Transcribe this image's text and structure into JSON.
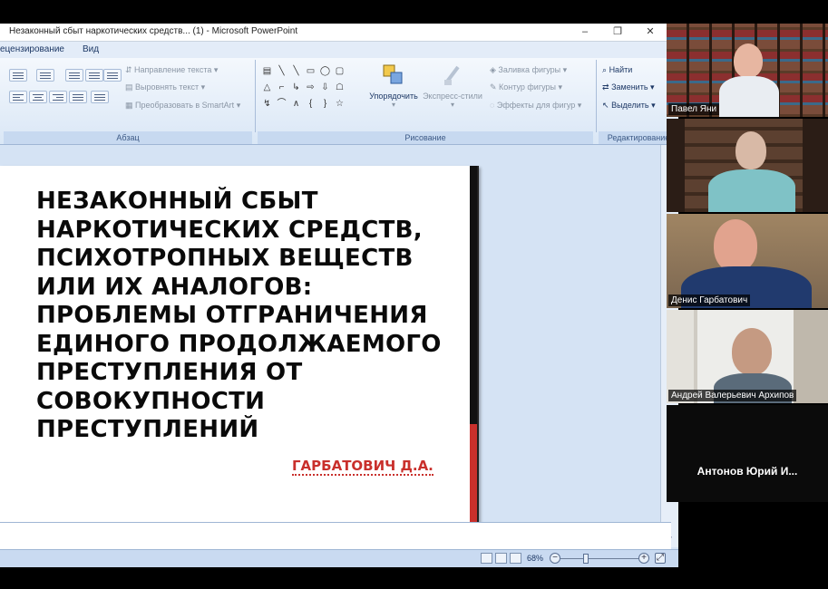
{
  "window": {
    "title": "Незаконный сбыт наркотических средств... (1)  -  Microsoft PowerPoint",
    "minimize": "‒",
    "restore": "❐",
    "close": "✕"
  },
  "tabs": [
    {
      "label": "ецензирование"
    },
    {
      "label": "Вид"
    }
  ],
  "ribbon": {
    "paragraph": {
      "group_label": "Абзац",
      "text_direction": "Направление текста",
      "align_text": "Выровнять текст",
      "smartart": "Преобразовать в SmartArt"
    },
    "drawing": {
      "group_label": "Рисование",
      "arrange": "Упорядочить",
      "quick_styles": "Экспресс-стили",
      "shape_fill": "Заливка фигуры",
      "shape_outline": "Контур фигуры",
      "shape_effects": "Эффекты для фигур"
    },
    "editing": {
      "group_label": "Редактирование",
      "find": "Найти",
      "replace": "Заменить",
      "select": "Выделить"
    }
  },
  "slide": {
    "title_lines": [
      "НЕЗАКОННЫЙ СБЫТ",
      "НАРКОТИЧЕСКИХ СРЕДСТВ,",
      "ПСИХОТРОПНЫХ ВЕЩЕСТВ",
      "ИЛИ ИХ АНАЛОГОВ:",
      "ПРОБЛЕМЫ ОТГРАНИЧЕНИЯ",
      "ЕДИНОГО ПРОДОЛЖАЕМОГО",
      "ПРЕСТУПЛЕНИЯ ОТ",
      "СОВОКУПНОСТИ",
      "ПРЕСТУПЛЕНИЙ"
    ],
    "author": "ГАРБАТОВИЧ Д.А.",
    "accent_colors": {
      "black": "#111111",
      "red": "#c9302c"
    }
  },
  "status": {
    "zoom": "68%",
    "zoom_level_percent": 68
  },
  "participants": [
    {
      "name": "Павел Яни"
    },
    {
      "name": ""
    },
    {
      "name": "Денис Гарбатович"
    },
    {
      "name": "Андрей Валерьевич Архипов"
    },
    {
      "name": "Антонов Юрий И..."
    }
  ]
}
